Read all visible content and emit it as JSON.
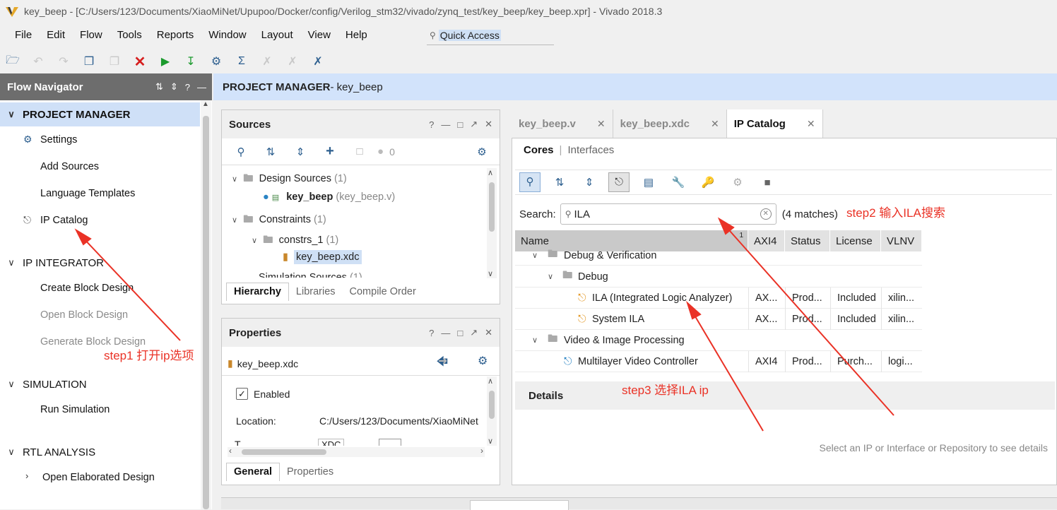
{
  "window": {
    "title": "key_beep - [C:/Users/123/Documents/XiaoMiNet/Upupoo/Docker/config/Verilog_stm32/vivado/zynq_test/key_beep/key_beep.xpr] - Vivado 2018.3"
  },
  "menu": [
    "File",
    "Edit",
    "Flow",
    "Tools",
    "Reports",
    "Window",
    "Layout",
    "View",
    "Help"
  ],
  "quick_access": "Quick Access",
  "flow_nav": {
    "title": "Flow Navigator",
    "sections": [
      {
        "label": "PROJECT MANAGER",
        "items": [
          "Settings",
          "Add Sources",
          "Language Templates",
          "IP Catalog"
        ]
      },
      {
        "label": "IP INTEGRATOR",
        "items": [
          "Create Block Design",
          "Open Block Design",
          "Generate Block Design"
        ]
      },
      {
        "label": "SIMULATION",
        "items": [
          "Run Simulation"
        ]
      },
      {
        "label": "RTL ANALYSIS",
        "items": [
          "Open Elaborated Design"
        ]
      }
    ]
  },
  "pm_bar": {
    "bold": "PROJECT MANAGER",
    "rest": " - key_beep"
  },
  "sources": {
    "title": "Sources",
    "badge": "0",
    "tree": [
      {
        "label": "Design Sources",
        "count": "(1)"
      },
      {
        "label": "key_beep",
        "extra": "(key_beep.v)"
      },
      {
        "label": "Constraints",
        "count": "(1)"
      },
      {
        "label": "constrs_1",
        "count": "(1)"
      },
      {
        "label": "key_beep.xdc"
      },
      {
        "label": "Simulation Sources",
        "count": "(1)"
      }
    ],
    "tabs": [
      "Hierarchy",
      "Libraries",
      "Compile Order"
    ]
  },
  "properties": {
    "title": "Properties",
    "file": "key_beep.xdc",
    "enabled": "Enabled",
    "location_label": "Location:",
    "location_value": "C:/Users/123/Documents/XiaoMiNet",
    "type_label": "T",
    "type_value": "XDC",
    "tabs": [
      "General",
      "Properties"
    ]
  },
  "doc_tabs": [
    "key_beep.v",
    "key_beep.xdc",
    "IP Catalog"
  ],
  "ip_catalog": {
    "subtabs": [
      "Cores",
      "Interfaces"
    ],
    "search_label": "Search:",
    "search_value": "ILA",
    "matches": "(4 matches)",
    "columns": [
      "Name",
      "AXI4",
      "Status",
      "License",
      "VLNV"
    ],
    "sort_indicator": "1",
    "rows": [
      {
        "name": "Debug & Verification"
      },
      {
        "name": "Debug"
      },
      {
        "name": "ILA (Integrated Logic Analyzer)",
        "axi4": "AX...",
        "status": "Prod...",
        "license": "Included",
        "vlnv": "xilin..."
      },
      {
        "name": "System ILA",
        "axi4": "AX...",
        "status": "Prod...",
        "license": "Included",
        "vlnv": "xilin..."
      },
      {
        "name": "Video & Image Processing"
      },
      {
        "name": "Multilayer Video Controller",
        "axi4": "AXI4",
        "status": "Prod...",
        "license": "Purch...",
        "vlnv": "logi..."
      }
    ],
    "details_title": "Details",
    "details_hint": "Select an IP or Interface or Repository to see details"
  },
  "annotations": {
    "step1": "step1 打开ip选项",
    "step2": "step2 输入ILA搜索",
    "step3": "step3 选择ILA ip",
    "color": "#ea3226"
  }
}
